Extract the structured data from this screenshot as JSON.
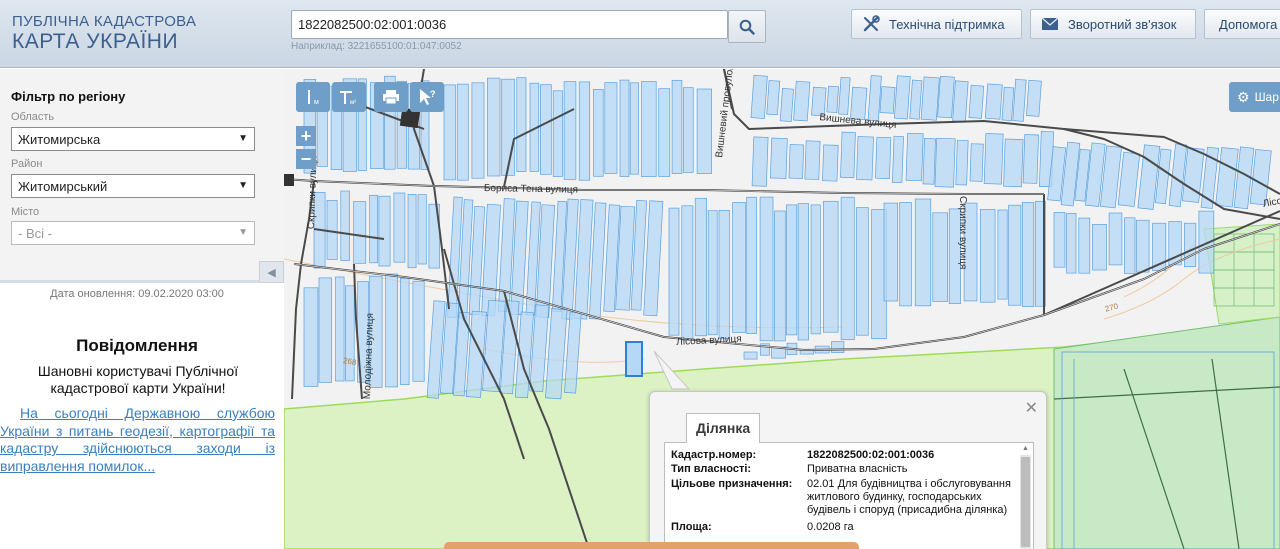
{
  "header": {
    "logo_line1": "ПУБЛІЧНА КАДАСТРОВА",
    "logo_line2": "КАРТА УКРАЇНИ",
    "search_value": "1822082500:02:001:0036",
    "search_example": "Наприклад: 3221655100:01:047:0052",
    "support_label": "Технічна підтримка",
    "feedback_label": "Зворотний зв'язок",
    "help_label": "Допомога"
  },
  "sidebar": {
    "filter_title": "Фільтр по регіону",
    "region_label": "Область",
    "region_value": "Житомирська",
    "district_label": "Район",
    "district_value": "Житомирський",
    "city_label": "Місто",
    "city_value": "- Всі -",
    "update_date": "Дата оновлення: 09.02.2020 03:00",
    "notice_title": "Повідомлення",
    "notice_text": "Шановні користувачі Публічної кадастрової карти України!",
    "notice_link": "На сьогодні Державною службою України з питань геодезії, картографії та кадастру здійснюються заходи із виправлення помилок..."
  },
  "map": {
    "settings_label": "Шар",
    "streets": {
      "vyshneva": "Вишнева вулиця",
      "vyshnevyi_prov": "Вишневий провулок",
      "borysa_tena": "Бориса Тена вулиця",
      "skrypky": "Скрипки вулиця",
      "lisova": "Лісова вулиця",
      "molodizhna": "Молодіжна вулиця",
      "lis": "Лісо",
      "num_270": "270",
      "num_268": "268"
    }
  },
  "popup": {
    "tab_label": "Ділянка",
    "rows": [
      {
        "key": "Кадастр.номер:",
        "value": "1822082500:02:001:0036"
      },
      {
        "key": "Тип власності:",
        "value": "Приватна власність"
      },
      {
        "key": "Цільове призначення:",
        "value": "02.01 Для будівництва і обслуговування житлового будинку, господарських будівель і споруд (присадибна ділянка)"
      },
      {
        "key": "Площа:",
        "value": "0.0208 га"
      }
    ]
  },
  "colors": {
    "parcel_fill": "#b4d8f5",
    "parcel_stroke": "#5aa0e0",
    "forest": "#ddf2c4",
    "forest_edge": "#9edb5a",
    "green_area": "#c8e9c6",
    "button_blue": "#6f9fc9"
  }
}
